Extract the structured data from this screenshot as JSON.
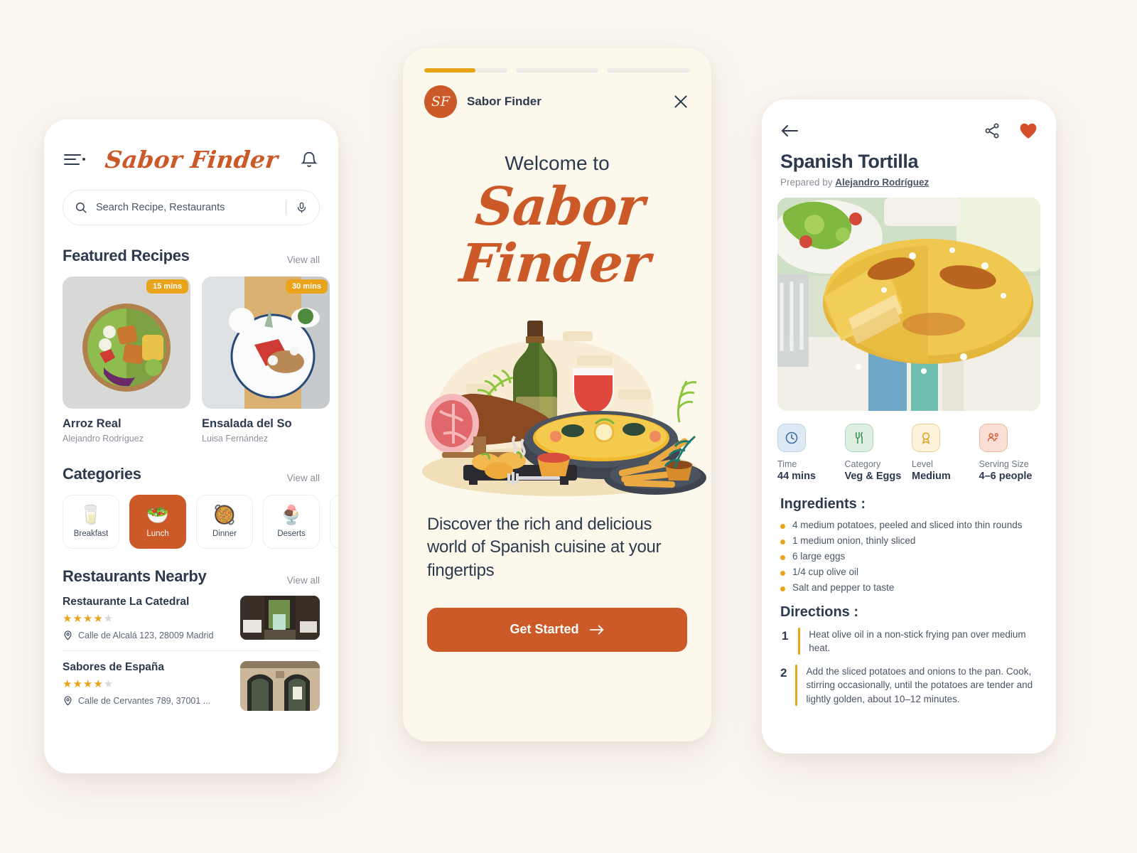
{
  "app": {
    "name": "Sabor Finder",
    "accent": "#cb5a28",
    "amber": "#eaa41b",
    "ink": "#2b3a4f",
    "page_bg": "#faf5ef"
  },
  "home": {
    "brand": "Sabor Finder",
    "search": {
      "placeholder": "Search Recipe, Restaurants",
      "value": ""
    },
    "featured": {
      "title": "Featured Recipes",
      "view_all": "View all",
      "items": [
        {
          "name": "Arroz Real",
          "author": "Alejandro Rodríguez",
          "time_badge": "15 mins"
        },
        {
          "name": "Ensalada del So",
          "author": "Luisa Fernández",
          "time_badge": "30 mins"
        }
      ]
    },
    "categories": {
      "title": "Categories",
      "view_all": "View all",
      "items": [
        {
          "label": "Breakfast",
          "emoji": "🥛",
          "active": false
        },
        {
          "label": "Lunch",
          "emoji": "🥗",
          "active": true
        },
        {
          "label": "Dinner",
          "emoji": "🥘",
          "active": false
        },
        {
          "label": "Deserts",
          "emoji": "🍨",
          "active": false
        },
        {
          "label": "",
          "emoji": "",
          "active": false
        }
      ]
    },
    "restaurants": {
      "title": "Restaurants Nearby",
      "view_all": "View all",
      "items": [
        {
          "name": "Restaurante La Catedral",
          "rating": 4,
          "address": "Calle de Alcalá 123, 28009 Madrid"
        },
        {
          "name": "Sabores de España",
          "rating": 4,
          "address": "Calle de Cervantes 789, 37001 ..."
        }
      ]
    }
  },
  "welcome": {
    "brand": "Sabor Finder",
    "logo_monogram": "SF",
    "progress": [
      {
        "fill_pct": 62,
        "active": true
      },
      {
        "fill_pct": 0,
        "active": false
      },
      {
        "fill_pct": 0,
        "active": false
      }
    ],
    "headline_small": "Welcome to",
    "headline_script": "Sabor Finder",
    "subtitle": "Discover the rich and delicious world of Spanish cuisine at your fingertips",
    "cta": "Get Started"
  },
  "recipe": {
    "title": "Spanish Tortilla",
    "prepared_by_label": "Prepared by ",
    "author": "Alejandro Rodríguez",
    "meta": [
      {
        "key": "Time",
        "value": "44 mins",
        "icon": "clock-icon",
        "tint_bg": "#dde9f5",
        "tint_fg": "#3f6d9e"
      },
      {
        "key": "Category",
        "value": "Veg & Eggs",
        "icon": "cutlery-icon",
        "tint_bg": "#dff0e2",
        "tint_fg": "#3e9157"
      },
      {
        "key": "Level",
        "value": "Medium",
        "icon": "medal-icon",
        "tint_bg": "#fdf0d8",
        "tint_fg": "#e0a325"
      },
      {
        "key": "Serving Size",
        "value": "4–6 people",
        "icon": "people-icon",
        "tint_bg": "#fadfd6",
        "tint_fg": "#d5643c"
      }
    ],
    "ingredients_title": "Ingredients :",
    "ingredients": [
      "4 medium potatoes, peeled and sliced into thin rounds",
      "1 medium onion, thinly sliced",
      "6 large eggs",
      "1/4 cup olive oil",
      "Salt and pepper to taste"
    ],
    "directions_title": "Directions :",
    "directions": [
      {
        "num": "1",
        "text": "Heat olive oil in a non-stick frying pan over medium heat."
      },
      {
        "num": "2",
        "text": "Add the sliced potatoes and onions to the pan. Cook, stirring occasionally, until the potatoes are tender and lightly golden, about 10–12 minutes."
      }
    ]
  }
}
